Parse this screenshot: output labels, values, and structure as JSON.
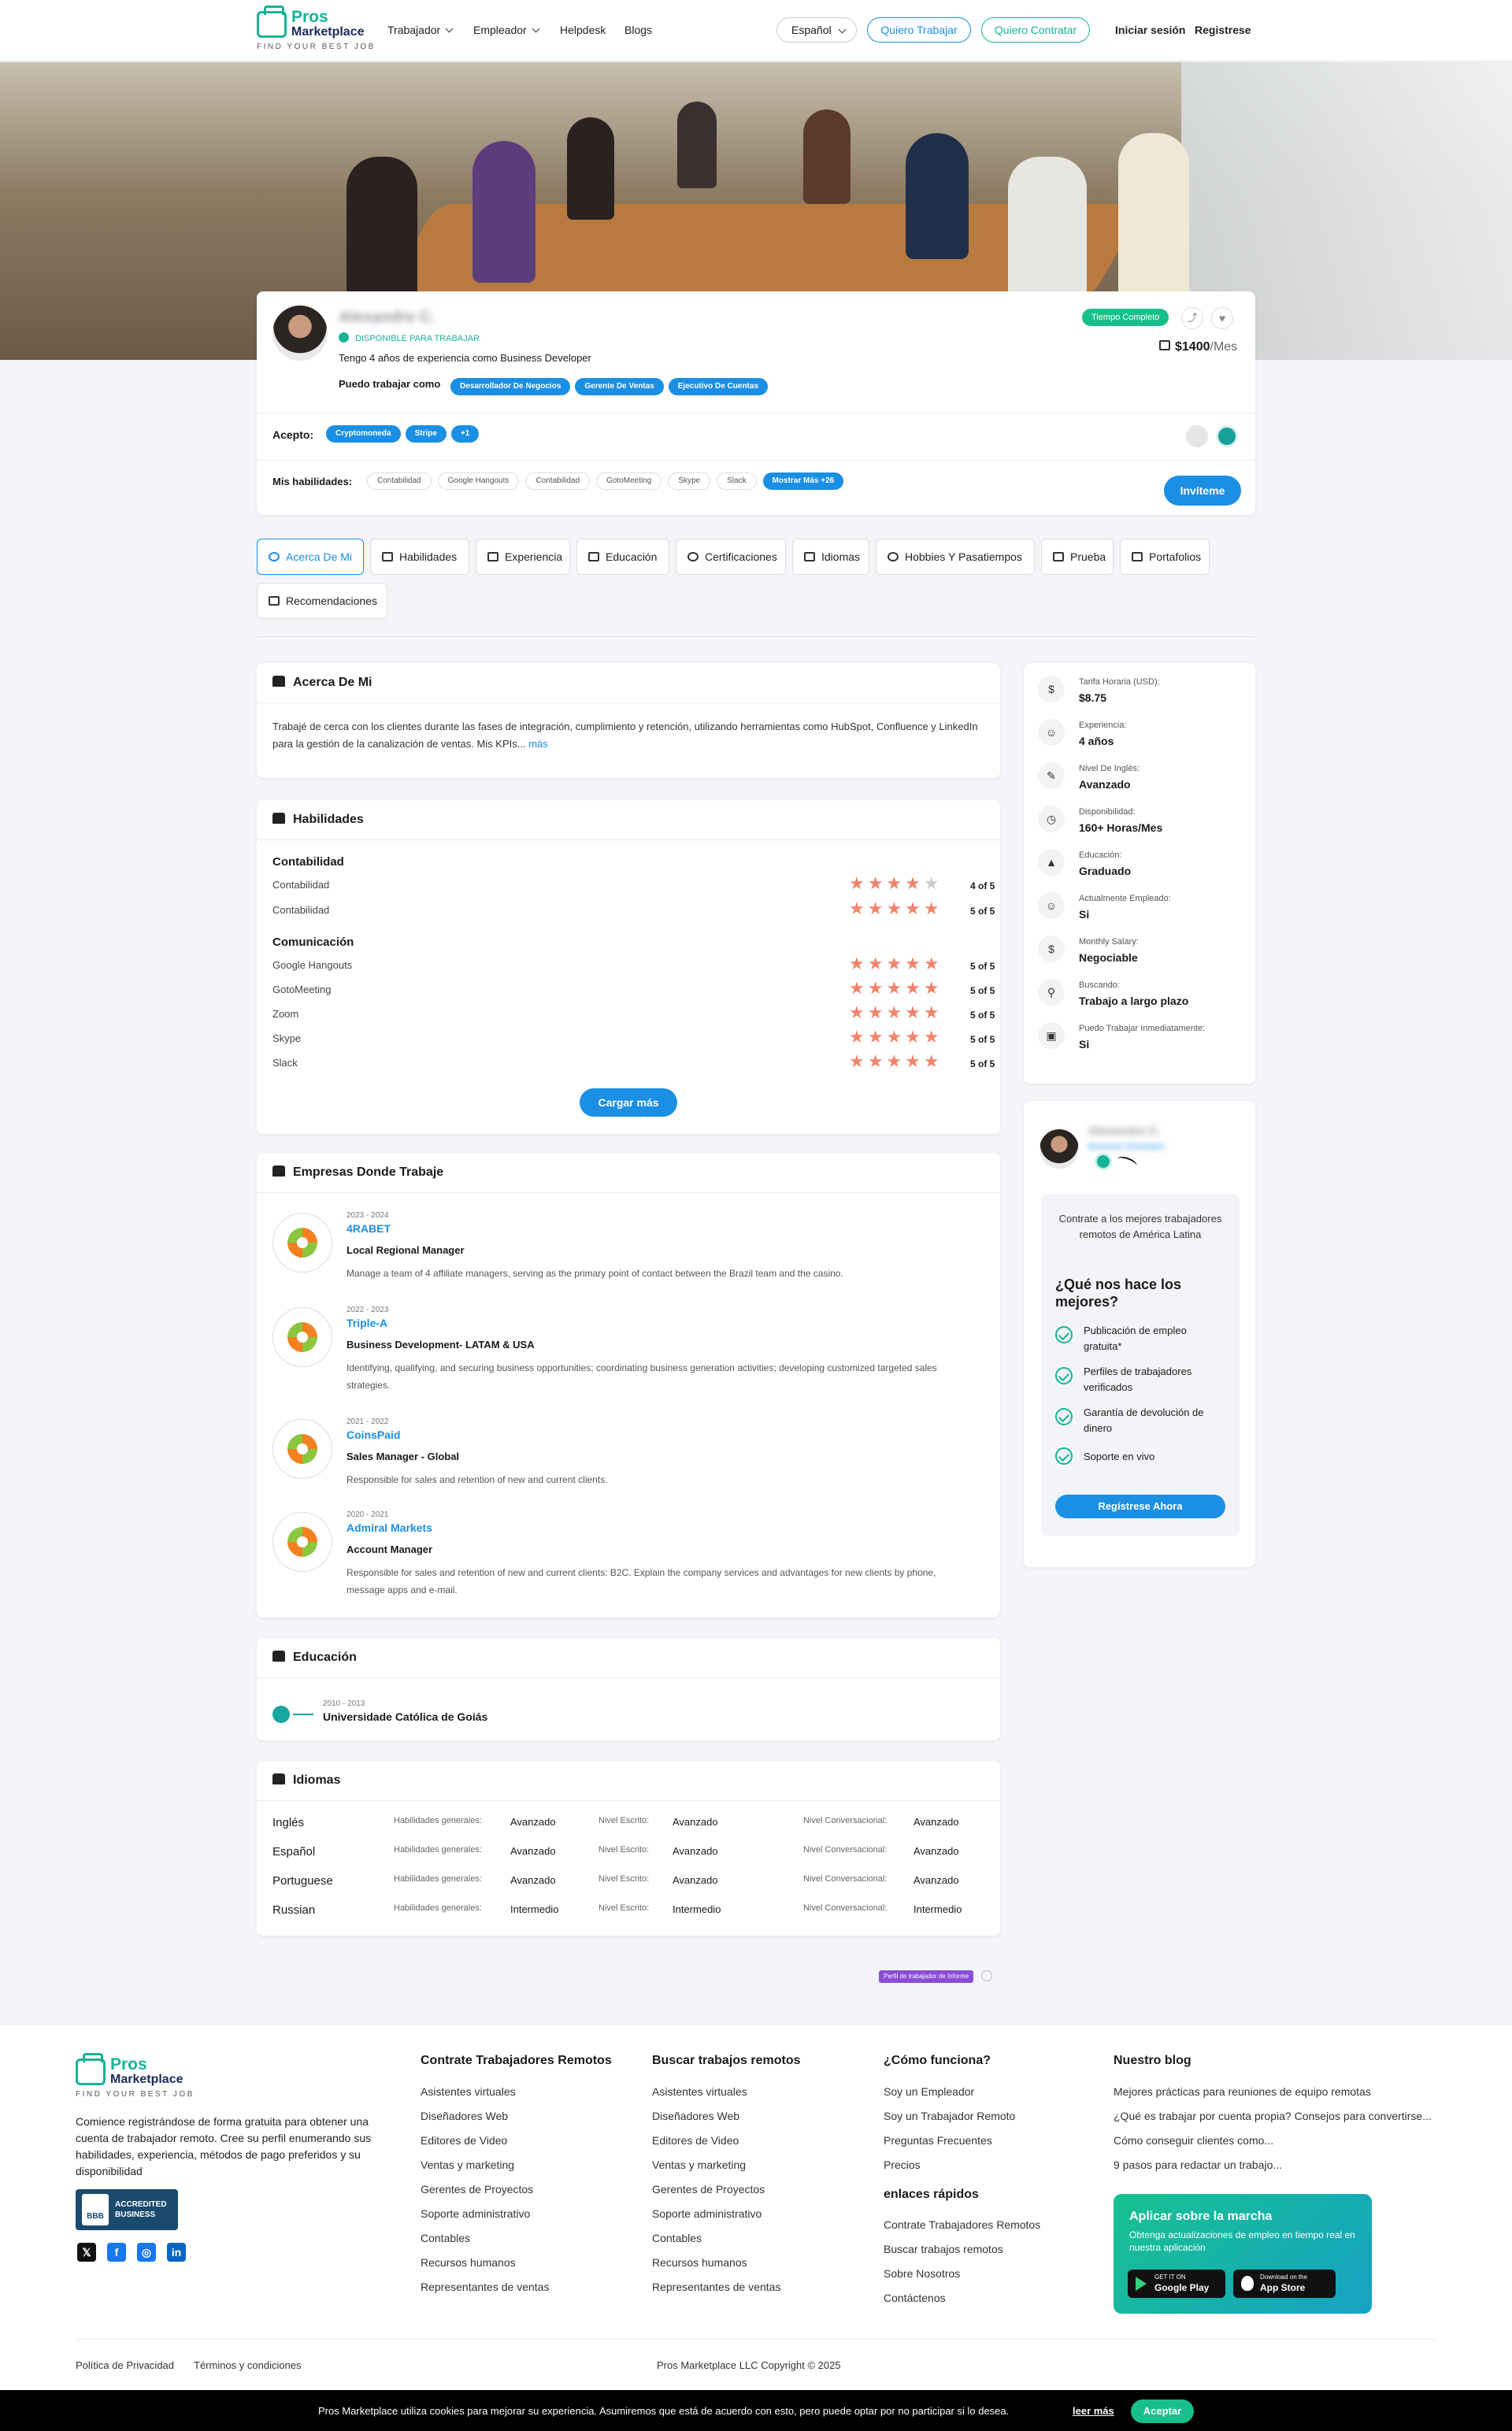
{
  "header": {
    "logo_line1": "Pros",
    "logo_line2": "Marketplace",
    "logo_tagline": "FIND YOUR BEST JOB",
    "nav": [
      "Trabajador",
      "Empleador",
      "Helpdesk",
      "Blogs"
    ],
    "language": "Español",
    "btn_worker": "Quiero Trabajar",
    "btn_hire": "Quiero Contratar",
    "login": "Iniciar sesión",
    "register": "Registrese"
  },
  "profile": {
    "name": "Alexandre C.",
    "availability": "DISPONIBLE PARA TRABAJAR",
    "headline": "Tengo 4 años de experiencia como Business Developer",
    "work_as_label": "Puedo trabajar como",
    "roles": [
      "Desarrollador De Negocios",
      "Gerente De Ventas",
      "Ejecutivo De Cuentas"
    ],
    "employment_type": "Tiempo Completo",
    "salary": "$1400",
    "salary_unit": "/Mes",
    "accept_label": "Acepto:",
    "accept": [
      "Cryptomoneda",
      "Stripe",
      "+1"
    ],
    "skills_label": "Mis habilidades:",
    "skills": [
      "Contabilidad",
      "Google Hangouts",
      "Contabilidad",
      "GotoMeeting",
      "Skype",
      "Slack"
    ],
    "skills_more": "Mostrar Más +26",
    "invite": "Invíteme"
  },
  "tabs": [
    "Acerca De Mi",
    "Habilidades",
    "Experiencia",
    "Educación",
    "Certificaciones",
    "Idiomas",
    "Hobbies Y Pasatiempos",
    "Prueba",
    "Portafolios",
    "Recomendaciones"
  ],
  "about": {
    "title": "Acerca De Mi",
    "text": "Trabajé de cerca con los clientes durante las fases de integración, cumplimiento y retención, utilizando herramientas como HubSpot, Confluence y LinkedIn para la gestión de la canalización de ventas. Mis KPIs...",
    "more": "más"
  },
  "skills": {
    "title": "Habilidades",
    "groups": [
      {
        "name": "Contabilidad",
        "items": [
          {
            "name": "Contabilidad",
            "rating": 4,
            "label": "4 of 5"
          },
          {
            "name": "Contabilidad",
            "rating": 5,
            "label": "5 of 5"
          }
        ]
      },
      {
        "name": "Comunicación",
        "items": [
          {
            "name": "Google Hangouts",
            "rating": 5,
            "label": "5 of 5"
          },
          {
            "name": "GotoMeeting",
            "rating": 5,
            "label": "5 of 5"
          },
          {
            "name": "Zoom",
            "rating": 5,
            "label": "5 of 5"
          },
          {
            "name": "Skype",
            "rating": 5,
            "label": "5 of 5"
          },
          {
            "name": "Slack",
            "rating": 5,
            "label": "5 of 5"
          }
        ]
      }
    ],
    "load_more": "Cargar más"
  },
  "experience": {
    "title": "Empresas Donde Trabaje",
    "items": [
      {
        "years": "2023 - 2024",
        "company": "4RABET",
        "role": "Local Regional Manager",
        "desc": "Manage a team of 4 affiliate managers, serving as the primary point of contact between the Brazil team and the casino."
      },
      {
        "years": "2022 - 2023",
        "company": "Triple-A",
        "role": "Business Development- LATAM & USA",
        "desc": "Identifying, qualifying, and securing business opportunities; coordinating business generation activities; developing customized targeted sales strategies."
      },
      {
        "years": "2021 - 2022",
        "company": "CoinsPaid",
        "role": "Sales Manager - Global",
        "desc": "Responsible for sales and retention of new and current clients."
      },
      {
        "years": "2020 - 2021",
        "company": "Admiral Markets",
        "role": "Account Manager",
        "desc": "Responsible for sales and retention of new and current clients: B2C. Explain the company services and advantages for new clients by phone, message apps and e-mail."
      }
    ]
  },
  "education": {
    "title": "Educación",
    "years": "2010 - 2013",
    "school": "Universidade Católica de Goiás"
  },
  "languages": {
    "title": "Idiomas",
    "l_general": "Habilidades generales:",
    "l_written": "Nivel Escrito:",
    "l_conv": "Nivel Conversacional:",
    "items": [
      {
        "name": "Inglés",
        "general": "Avanzado",
        "written": "Avanzado",
        "conv": "Avanzado"
      },
      {
        "name": "Español",
        "general": "Avanzado",
        "written": "Avanzado",
        "conv": "Avanzado"
      },
      {
        "name": "Portuguese",
        "general": "Avanzado",
        "written": "Avanzado",
        "conv": "Avanzado"
      },
      {
        "name": "Russian",
        "general": "Intermedio",
        "written": "Intermedio",
        "conv": "Intermedio"
      }
    ]
  },
  "report": "Perfil de trabajador de Informe",
  "sidebar": {
    "stats": [
      {
        "label": "Tarifa Horaria (USD):",
        "value": "$8.75",
        "icon": "dollar-icon"
      },
      {
        "label": "Experiencia:",
        "value": "4 años",
        "icon": "user-plus-icon"
      },
      {
        "label": "Nivel De Inglés:",
        "value": "Avanzado",
        "icon": "language-icon"
      },
      {
        "label": "Disponibilidad:",
        "value": "160+ Horas/Mes",
        "icon": "clock-icon"
      },
      {
        "label": "Educación:",
        "value": "Graduado",
        "icon": "graduation-icon"
      },
      {
        "label": "Actualmente Empleado:",
        "value": "Si",
        "icon": "user-icon"
      },
      {
        "label": "Monthly Salary:",
        "value": "Negociable",
        "icon": "dollar-icon"
      },
      {
        "label": "Buscando:",
        "value": "Trabajo a largo plazo",
        "icon": "search-user-icon"
      },
      {
        "label": "Puedo Trabajar Inmediatamente:",
        "value": "Si",
        "icon": "briefcase-icon"
      }
    ],
    "promo_name": "Alexandre C.",
    "promo_sub": "Business Developer",
    "promo_text": "Contrate a los mejores trabajadores remotos de América Latina",
    "promo_question": "¿Qué nos hace los mejores?",
    "promo_points": [
      "Publicación de empleo gratuita*",
      "Perfiles de trabajadores verificados",
      "Garantía de devolución de dinero",
      "Soporte en vivo"
    ],
    "promo_cta": "Regístrese Ahora"
  },
  "footer": {
    "about": "Comience registrándose de forma gratuita para obtener una cuenta de trabajador remoto. Cree su perfil enumerando sus habilidades, experiencia, métodos de pago preferidos y su disponibilidad",
    "bbb_1": "ACCREDITED",
    "bbb_2": "BUSINESS",
    "col1_title": "Contrate Trabajadores Remotos",
    "col1": [
      "Asistentes virtuales",
      "Diseñadores Web",
      "Editores de Video",
      "Ventas y marketing",
      "Gerentes de Proyectos",
      "Soporte administrativo",
      "Contables",
      "Recursos humanos",
      "Representantes de ventas"
    ],
    "col2_title": "Buscar trabajos remotos",
    "col2": [
      "Asistentes virtuales",
      "Diseñadores Web",
      "Editores de Video",
      "Ventas y marketing",
      "Gerentes de Proyectos",
      "Soporte administrativo",
      "Contables",
      "Recursos humanos",
      "Representantes de ventas"
    ],
    "col3_title": "¿Cómo funciona?",
    "col3": [
      "Soy un Empleador",
      "Soy un Trabajador Remoto",
      "Preguntas Frecuentes",
      "Precios"
    ],
    "col3b_title": "enlaces rápidos",
    "col3b": [
      "Contrate Trabajadores Remotos",
      "Buscar trabajos remotos",
      "Sobre Nosotros",
      "Contáctenos"
    ],
    "col4_title": "Nuestro blog",
    "col4": [
      "Mejores prácticas para reuniones de equipo remotas",
      "¿Qué es trabajar por cuenta propia? Consejos para convertirse...",
      "Cómo conseguir clientes como...",
      "9 pasos para redactar un trabajo..."
    ],
    "app_title": "Aplicar sobre la marcha",
    "app_text": "Obtenga actualizaciones de empleo en tiempo real en nuestra aplicación",
    "gp_small": "GET IT ON",
    "gp_big": "Google Play",
    "as_small": "Download on the",
    "as_big": "App Store",
    "privacy": "Política de Privacidad",
    "terms": "Términos y condiciones",
    "copyright": "Pros Marketplace LLC Copyright © 2025"
  },
  "cookie": {
    "text": "Pros Marketplace utiliza cookies para mejorar su experiencia. Asumiremos que está de acuerdo con esto, pero puede optar por no participar si lo desea.",
    "more": "leer más",
    "accept": "Aceptar"
  }
}
